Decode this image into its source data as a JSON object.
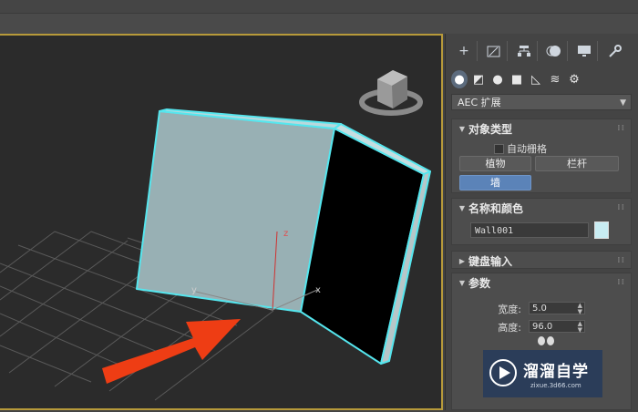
{
  "panel": {
    "tabs": [
      "create-icon",
      "modify-icon",
      "hierarchy-icon",
      "motion-icon",
      "display-icon",
      "utilities-icon"
    ],
    "subcategories": [
      "geometry-icon",
      "shapes-icon",
      "lights-icon",
      "cameras-icon",
      "helpers-icon",
      "spacewarps-icon",
      "systems-icon"
    ],
    "dropdown": {
      "value": "AEC 扩展"
    },
    "object_type": {
      "title": "对象类型",
      "autogrid_label": "自动栅格",
      "buttons": [
        "植物",
        "栏杆",
        "墙"
      ]
    },
    "name_color": {
      "title": "名称和颜色",
      "name_value": "Wall001",
      "color": "#c8ecf2"
    },
    "keyboard_input": {
      "title": "键盘输入"
    },
    "parameters": {
      "title": "参数",
      "width_label": "宽度:",
      "width_value": "5.0",
      "height_label": "高度:",
      "height_value": "96.0"
    }
  },
  "viewport": {
    "axis_labels": [
      "z",
      "y",
      "x"
    ],
    "object_color": "#55e6ee"
  },
  "watermark": {
    "title": "溜溜自学",
    "subtitle": "zixue.3d66.com"
  }
}
